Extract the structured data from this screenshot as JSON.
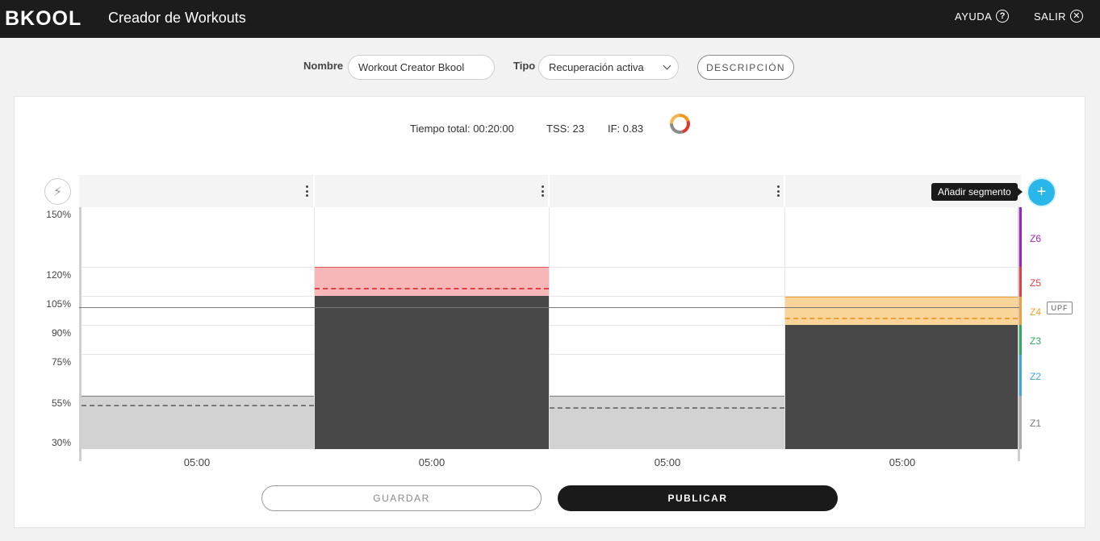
{
  "header": {
    "logo": "BKOOL",
    "title": "Creador de Workouts",
    "help_label": "AYUDA",
    "help_icon": "question-circle-icon",
    "exit_label": "SALIR",
    "exit_icon": "close-circle-icon"
  },
  "form": {
    "name_label": "Nombre",
    "name_value": "Workout Creator Bkool",
    "type_label": "Tipo",
    "type_value": "Recuperación activa",
    "description_button": "DESCRIPCIÓN"
  },
  "stats": {
    "total_time": "Tiempo total: 00:20:00",
    "tss": "TSS: 23",
    "if": "IF: 0.83"
  },
  "editor": {
    "add_segment_tooltip": "Añadir segmento",
    "upf_label": "UPF",
    "y_ticks": [
      "150%",
      "120%",
      "105%",
      "90%",
      "75%",
      "55%",
      "30%"
    ],
    "zones": [
      "Z6",
      "Z5",
      "Z4",
      "Z3",
      "Z2",
      "Z1"
    ],
    "zone_colors": {
      "Z6": "#a020c8",
      "Z5": "#e04040",
      "Z4": "#f0a030",
      "Z3": "#2fa860",
      "Z2": "#3ca8d8",
      "Z1": "#777777"
    },
    "segments": [
      {
        "duration": "05:00",
        "zone": "Z1"
      },
      {
        "duration": "05:00",
        "zone": "Z5"
      },
      {
        "duration": "05:00",
        "zone": "Z1"
      },
      {
        "duration": "05:00",
        "zone": "Z4"
      }
    ]
  },
  "actions": {
    "save": "GUARDAR",
    "publish": "PUBLICAR"
  }
}
